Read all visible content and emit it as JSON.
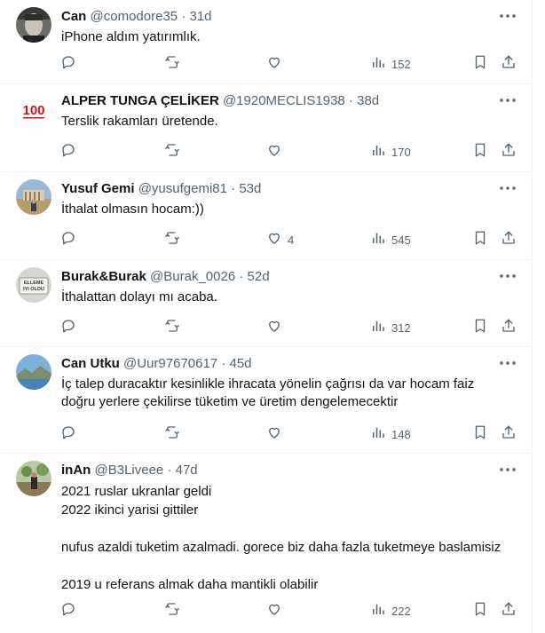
{
  "icons": {
    "reply": "reply-icon",
    "retweet": "retweet-icon",
    "like": "like-icon",
    "views": "views-icon",
    "bookmark": "bookmark-icon",
    "share": "share-icon",
    "more": "more-icon"
  },
  "colors": {
    "text": "#0f1419",
    "secondary": "#536471",
    "divider": "#eff3f4"
  },
  "tweets": [
    {
      "name": "Can",
      "handle": "@comodore35",
      "separator": "·",
      "age": "31d",
      "lines": [
        "iPhone aldım yatırımlık."
      ],
      "likes": "",
      "views": "152"
    },
    {
      "name": "ALPER TUNGA ÇELİKER",
      "handle": "@1920MECLIS1938",
      "separator": "·",
      "age": "38d",
      "lines": [
        "Terslik rakamları üretende."
      ],
      "likes": "",
      "views": "170",
      "avatar_text": "100"
    },
    {
      "name": "Yusuf Gemi",
      "handle": "@yusufgemi81",
      "separator": "·",
      "age": "53d",
      "lines": [
        "İthalat olmasın hocam:))"
      ],
      "likes": "4",
      "views": "545"
    },
    {
      "name": "Burak&Burak",
      "handle": "@Burak_0026",
      "separator": "·",
      "age": "52d",
      "lines": [
        "İthalattan dolayı mı acaba."
      ],
      "likes": "",
      "views": "312",
      "avatar_text": [
        "ELLEME",
        "IYI OLDU"
      ]
    },
    {
      "name": "Can Utku",
      "handle": "@Uur97670617",
      "separator": "·",
      "age": "45d",
      "lines": [
        "İç talep duracaktır kesinlikle ihracata yönelin çağrısı da var hocam faiz",
        "doğru yerlere çekilirse tüketim ve üretim dengelemecektir"
      ],
      "likes": "",
      "views": "148"
    },
    {
      "name": "inAn",
      "handle": "@B3Liveee",
      "separator": "·",
      "age": "47d",
      "lines": [
        "2021 ruslar ukranlar geldi",
        "2022 ikinci yarisi gittiler",
        "",
        "nufus azaldi tuketim azalmadi. gorece biz daha fazla tuketmeye baslamisiz",
        "",
        "2019 u referans almak daha mantikli olabilir"
      ],
      "likes": "",
      "views": "222"
    }
  ]
}
